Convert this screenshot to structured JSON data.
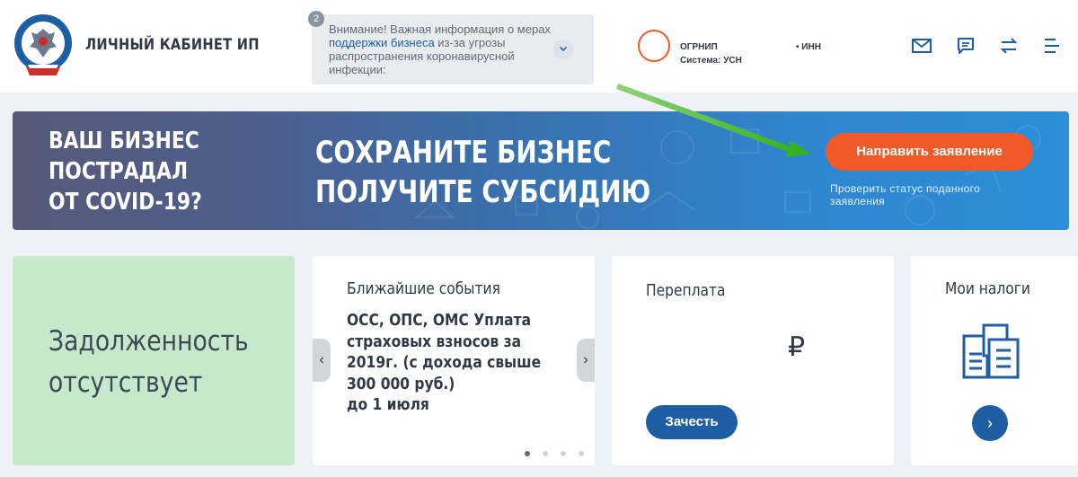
{
  "header": {
    "title": "ЛИЧНЫЙ КАБИНЕТ ИП",
    "notice": {
      "count": "2",
      "text_before": "Внимание! Важная информация о мерах ",
      "link": "поддержки бизнеса",
      "text_after": " из-за угрозы распространения коронавирусной инфекции:"
    },
    "profile": {
      "ogrnip_label": "ОГРНИП",
      "regime": "Система: УСН",
      "inn_label": "• ИНН"
    },
    "icons": [
      "mail-icon",
      "chat-icon",
      "exchange-icon",
      "menu-icon"
    ]
  },
  "banner": {
    "left_lines": [
      "ВАШ БИЗНЕС",
      "ПОСТРАДАЛ",
      "ОТ COVID-19?"
    ],
    "mid_lines": [
      "СОХРАНИТЕ БИЗНЕС",
      "ПОЛУЧИТЕ СУБСИДИЮ"
    ],
    "apply_button": "Направить заявление",
    "status_link": "Проверить статус поданного заявления"
  },
  "cards": {
    "debt": {
      "lines": [
        "Задолженность",
        "отсутствует"
      ]
    },
    "events": {
      "title": "Ближайшие события",
      "body_lines": [
        "ОСС, ОПС, ОМС Уплата",
        "страховых взносов за",
        "2019г. (с дохода свыше",
        "300 000 руб.)",
        "до 1 июля"
      ],
      "prev": "‹",
      "next": "›"
    },
    "overpay": {
      "title": "Переплата",
      "currency": "₽",
      "button": "Зачесть"
    },
    "taxes": {
      "title": "Мои налоги",
      "go": "›"
    }
  },
  "colors": {
    "accent_orange": "#f05a28",
    "primary_blue": "#1e5fa3",
    "debt_green": "#c7e9cb",
    "arrow_green": "#35b51e"
  }
}
